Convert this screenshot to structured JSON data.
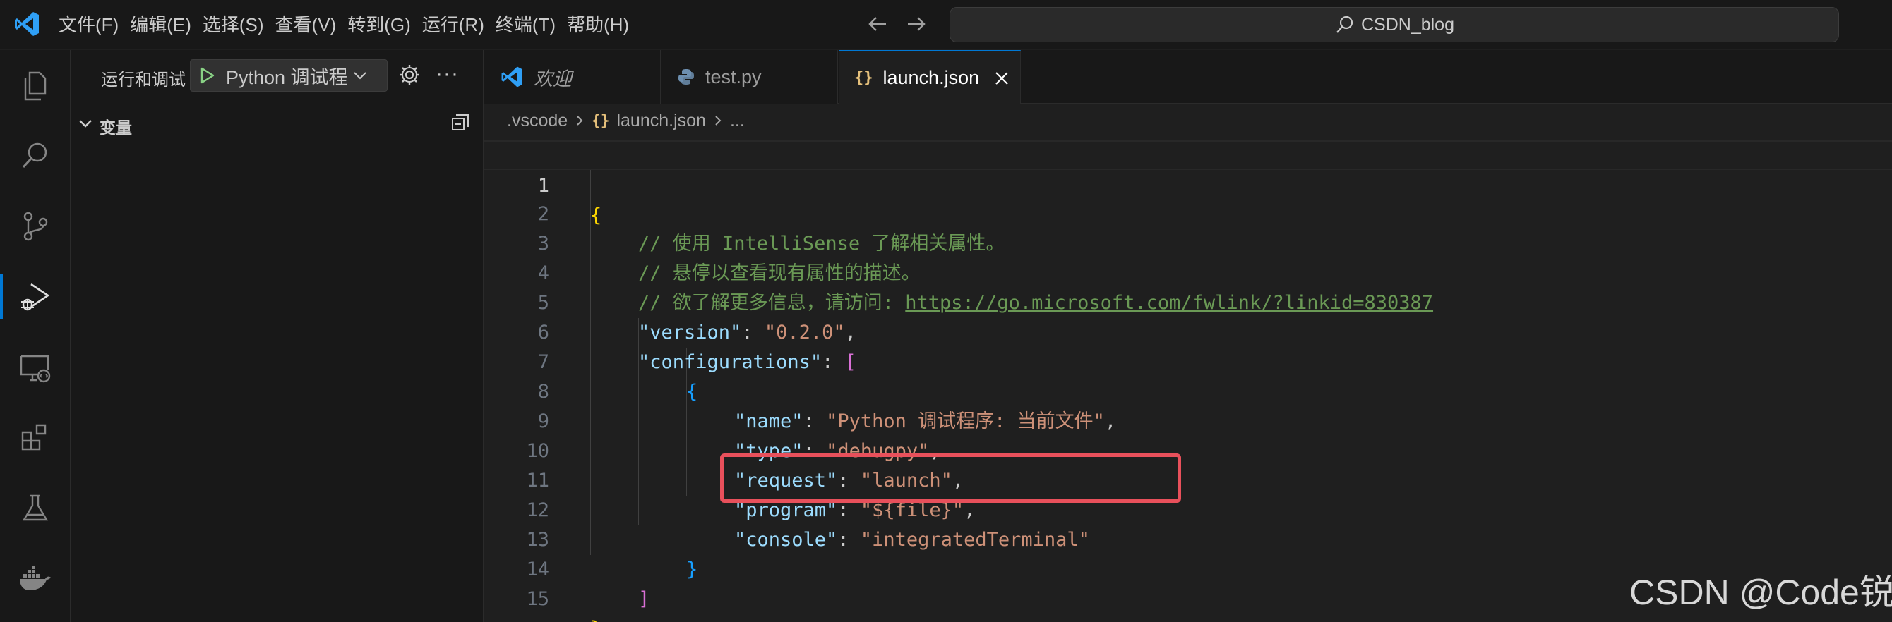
{
  "titlebar": {
    "menu": [
      "文件(F)",
      "编辑(E)",
      "选择(S)",
      "查看(V)",
      "转到(G)",
      "运行(R)",
      "终端(T)",
      "帮助(H)"
    ],
    "search_text": "CSDN_blog"
  },
  "activitybar": {
    "items": [
      "explorer-icon",
      "search-icon",
      "source-control-icon",
      "run-debug-icon",
      "remote-explorer-icon",
      "extensions-icon",
      "testing-icon",
      "docker-icon"
    ],
    "active": "run-debug-icon"
  },
  "sidebar": {
    "title": "运行和调试",
    "config_label": "Python 调试程",
    "section_title": "变量"
  },
  "tabs": [
    {
      "label": "欢迎",
      "icon": "vscode-icon"
    },
    {
      "label": "test.py",
      "icon": "python-icon"
    },
    {
      "label": "launch.json",
      "icon": "json-icon",
      "active": true
    }
  ],
  "breadcrumb": {
    "folder": ".vscode",
    "file_icon": "{}",
    "file": "launch.json",
    "more": "..."
  },
  "code": {
    "line_numbers": [
      "1",
      "2",
      "3",
      "4",
      "5",
      "6",
      "7",
      "8",
      "9",
      "10",
      "11",
      "12",
      "13",
      "14",
      "15"
    ],
    "comment1": "// 使用 IntelliSense 了解相关属性。",
    "comment2": "// 悬停以查看现有属性的描述。",
    "comment3_prefix": "// 欲了解更多信息，请访问: ",
    "comment3_link": "https://go.microsoft.com/fwlink/?linkid=830387",
    "version_key": "\"version\"",
    "version_value": "\"0.2.0\"",
    "configurations_key": "\"configurations\"",
    "name_key": "\"name\"",
    "name_value": "\"Python 调试程序: 当前文件\"",
    "type_key": "\"type\"",
    "type_value": "\"debugpy\"",
    "request_key": "\"request\"",
    "request_value": "\"launch\"",
    "program_key": "\"program\"",
    "program_value": "\"${file}\"",
    "console_key": "\"console\"",
    "console_value": "\"integratedTerminal\""
  },
  "watermark": "CSDN @Code锐",
  "colors": {
    "accent": "#0078d4",
    "highlight_box": "#e8505b"
  }
}
